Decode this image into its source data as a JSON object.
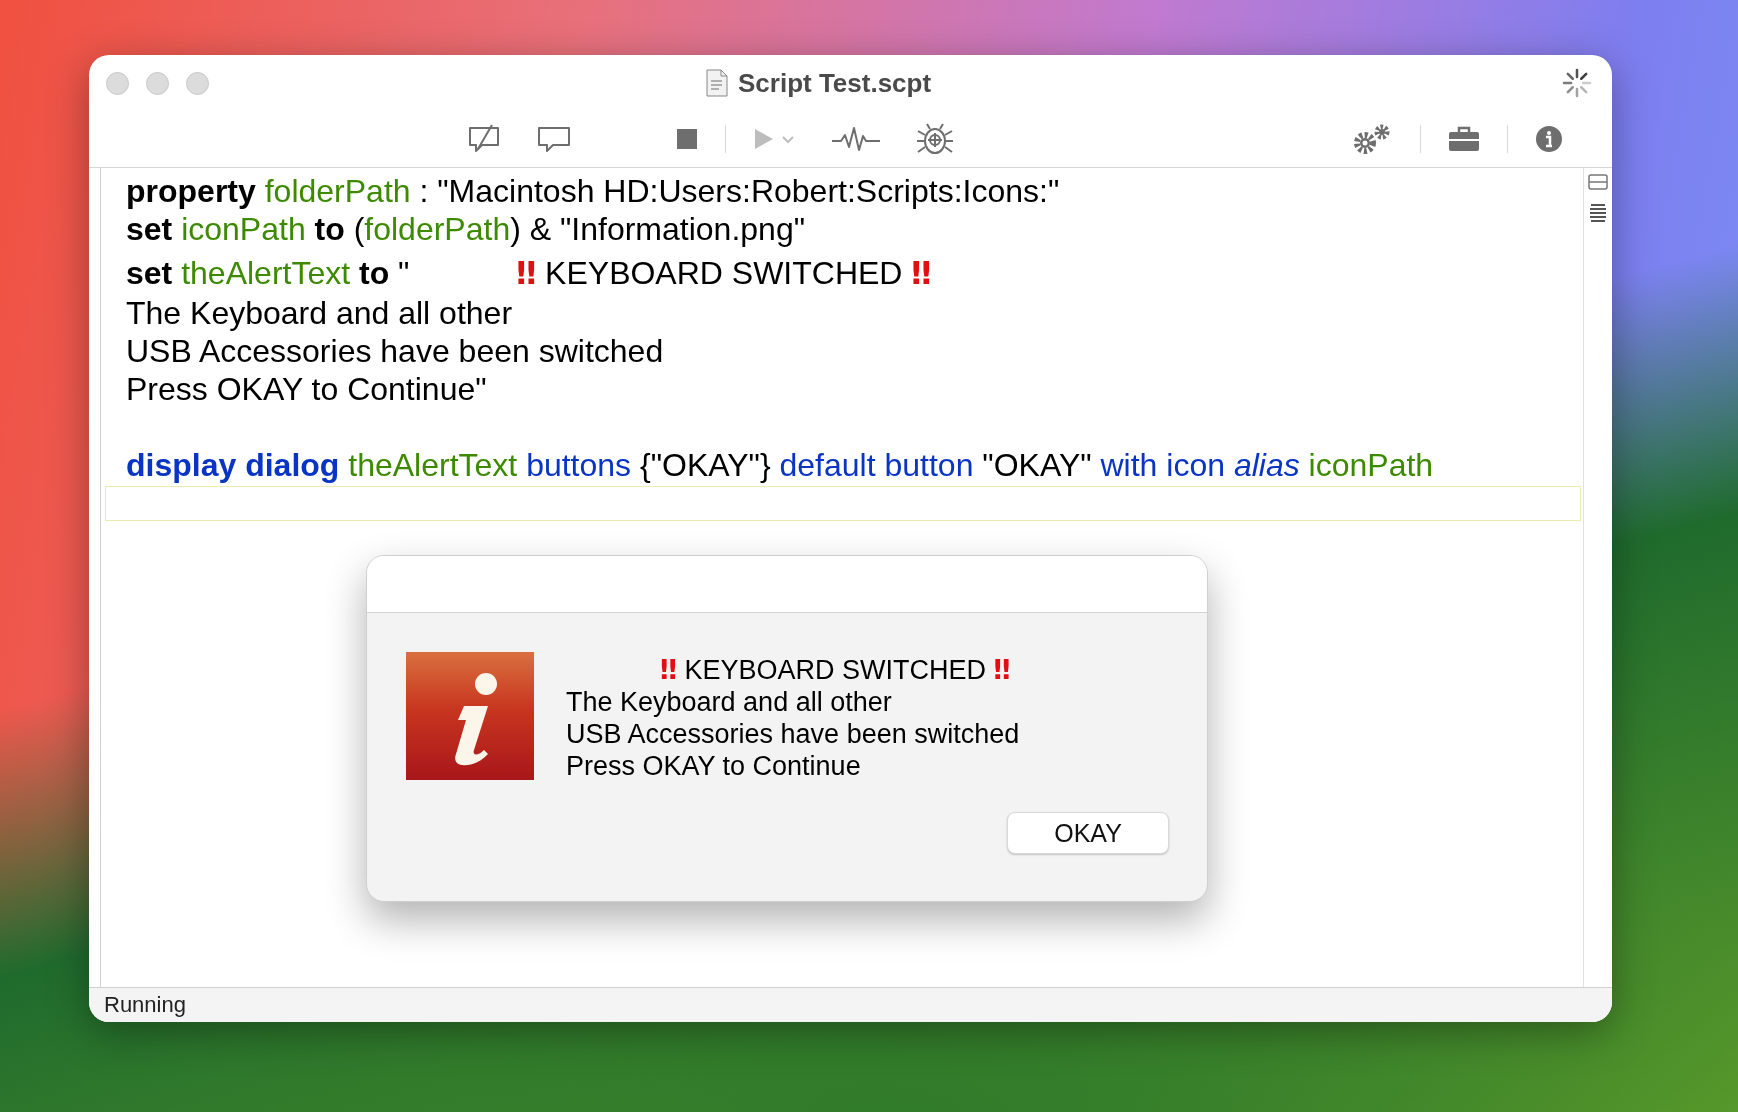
{
  "window": {
    "title": "Script Test.scpt",
    "status_bar": "Running"
  },
  "toolbar": [
    {
      "kind": "uncomment",
      "disabled": false
    },
    {
      "kind": "comment",
      "disabled": false
    },
    {
      "kind": "stop",
      "disabled": false
    },
    {
      "kind": "run",
      "disabled": true
    },
    {
      "kind": "record",
      "disabled": false
    },
    {
      "kind": "debug",
      "disabled": false
    },
    {
      "kind": "gears",
      "disabled": false
    },
    {
      "kind": "library",
      "disabled": false
    },
    {
      "kind": "info",
      "disabled": false
    }
  ],
  "code": {
    "lines": [
      {
        "kind": "code",
        "tokens": [
          {
            "kind": "keyword",
            "text": "property "
          },
          {
            "kind": "variable",
            "text": "folderPath"
          },
          {
            "kind": "plain",
            "text": " : \"Macintosh HD:Users:Robert:Scripts:Icons:\""
          }
        ]
      },
      {
        "kind": "code",
        "tokens": [
          {
            "kind": "keyword",
            "text": "set "
          },
          {
            "kind": "variable",
            "text": "iconPath"
          },
          {
            "kind": "keyword",
            "text": " to"
          },
          {
            "kind": "plain",
            "text": " ("
          },
          {
            "kind": "variable",
            "text": "folderPath"
          },
          {
            "kind": "plain",
            "text": ") & \"Information.png\""
          }
        ]
      },
      {
        "kind": "code",
        "tokens": [
          {
            "kind": "keyword",
            "text": "set "
          },
          {
            "kind": "variable",
            "text": "theAlertText"
          },
          {
            "kind": "keyword",
            "text": " to"
          },
          {
            "kind": "plain",
            "text": " \"            "
          },
          {
            "kind": "mark",
            "text": "‼"
          },
          {
            "kind": "plain",
            "text": " KEYBOARD SWITCHED "
          },
          {
            "kind": "mark",
            "text": "‼"
          }
        ]
      },
      {
        "kind": "code",
        "tokens": [
          {
            "kind": "plain",
            "text": "The Keyboard and all other"
          }
        ]
      },
      {
        "kind": "code",
        "tokens": [
          {
            "kind": "plain",
            "text": "USB Accessories have been switched"
          }
        ]
      },
      {
        "kind": "code",
        "tokens": [
          {
            "kind": "plain",
            "text": "Press OKAY to Continue\""
          }
        ]
      },
      {
        "kind": "blank"
      },
      {
        "kind": "code",
        "tokens": [
          {
            "kind": "command",
            "text": "display dialog"
          },
          {
            "kind": "variable",
            "text": " theAlertText"
          },
          {
            "kind": "parameter",
            "text": " buttons"
          },
          {
            "kind": "plain",
            "text": " {\"OKAY\"}"
          },
          {
            "kind": "parameter",
            "text": " default button"
          },
          {
            "kind": "plain",
            "text": " \"OKAY\""
          },
          {
            "kind": "parameter",
            "text": " with icon "
          },
          {
            "kind": "italic",
            "text": "alias"
          },
          {
            "kind": "variable",
            "text": " iconPath"
          }
        ]
      },
      {
        "kind": "current"
      }
    ]
  },
  "dialog": {
    "message_lines": [
      {
        "tokens": [
          {
            "kind": "mark",
            "text": "          ‼"
          },
          {
            "kind": "plain",
            "text": " KEYBOARD SWITCHED "
          },
          {
            "kind": "mark",
            "text": "‼"
          }
        ]
      },
      {
        "tokens": [
          {
            "kind": "plain",
            "text": "The Keyboard and all other"
          }
        ]
      },
      {
        "tokens": [
          {
            "kind": "plain",
            "text": "USB Accessories have been switched"
          }
        ]
      },
      {
        "tokens": [
          {
            "kind": "plain",
            "text": "Press OKAY to Continue"
          }
        ]
      }
    ],
    "buttons": [
      {
        "label": "OKAY"
      }
    ]
  }
}
